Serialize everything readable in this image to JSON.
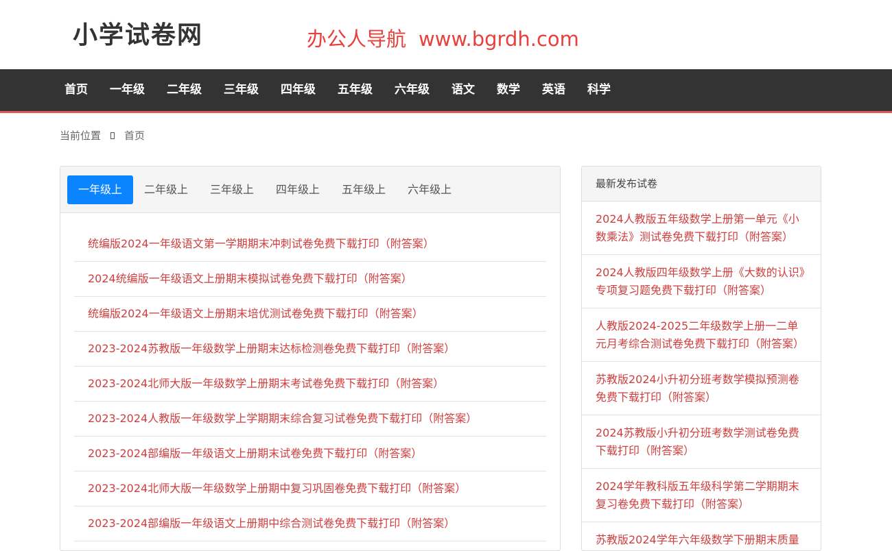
{
  "header": {
    "logo": "小学试卷网",
    "promo_name": "办公人导航",
    "promo_url": "www.bgrdh.com"
  },
  "nav": [
    "首页",
    "一年级",
    "二年级",
    "三年级",
    "四年级",
    "五年级",
    "六年级",
    "语文",
    "数学",
    "英语",
    "科学"
  ],
  "breadcrumb": {
    "label": "当前位置",
    "home": "首页"
  },
  "tabs": [
    "一年级上",
    "二年级上",
    "三年级上",
    "四年级上",
    "五年级上",
    "六年级上"
  ],
  "articles": [
    "统编版2024一年级语文第一学期期末冲刺试卷免费下载打印（附答案）",
    "2024统编版一年级语文上册期末模拟试卷免费下载打印（附答案）",
    "统编版2024一年级语文上册期末培优测试卷免费下载打印（附答案）",
    "2023-2024苏教版一年级数学上册期末达标检测卷免费下载打印（附答案）",
    "2023-2024北师大版一年级数学上册期末考试卷免费下载打印（附答案）",
    "2023-2024人教版一年级数学上学期期末综合复习试卷免费下载打印（附答案）",
    "2023-2024部编版一年级语文上册期末试卷免费下载打印（附答案）",
    "2023-2024北师大版一年级数学上册期中复习巩固卷免费下载打印（附答案）",
    "2023-2024部编版一年级语文上册期中综合测试卷免费下载打印（附答案）"
  ],
  "latest": {
    "title": "最新发布试卷",
    "items": [
      "2024人教版五年级数学上册第一单元《小数乘法》测试卷免费下载打印（附答案）",
      "2024人教版四年级数学上册《大数的认识》专项复习题免费下载打印（附答案）",
      "人教版2024-2025二年级数学上册一二单元月考综合测试卷免费下载打印（附答案）",
      "苏教版2024小升初分班考数学模拟预测卷免费下载打印（附答案）",
      "2024苏教版小升初分班考数学测试卷免费下载打印（附答案）",
      "2024学年教科版五年级科学第二学期期末复习卷免费下载打印（附答案）",
      "苏教版2024学年六年级数学下册期末质量"
    ]
  },
  "colors": {
    "accent": "#0a84ff",
    "link": "#cf3e3e",
    "promo": "#e8403c",
    "nav_bg": "#333333",
    "nav_border": "#e05656"
  }
}
